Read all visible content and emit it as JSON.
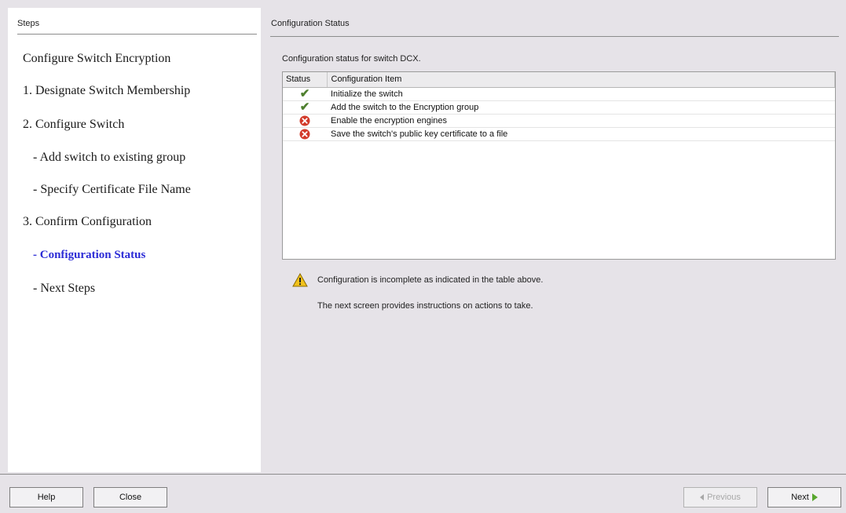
{
  "steps_panel": {
    "header": "Steps",
    "items": [
      {
        "label": "Configure Switch Encryption",
        "current": false
      },
      {
        "label": "1. Designate Switch Membership",
        "current": false
      },
      {
        "label": "2. Configure Switch",
        "current": false
      },
      {
        "label": "- Add switch to existing group",
        "current": false
      },
      {
        "label": "- Specify Certificate File Name",
        "current": false
      },
      {
        "label": "3. Confirm Configuration",
        "current": false
      },
      {
        "label": "- Configuration Status",
        "current": true
      },
      {
        "label": "- Next Steps",
        "current": false
      }
    ]
  },
  "content": {
    "header": "Configuration Status",
    "status_label": "Configuration status for switch DCX.",
    "table": {
      "columns": [
        "Status",
        "Configuration Item"
      ],
      "rows": [
        {
          "status": "check",
          "item": "Initialize the switch"
        },
        {
          "status": "check",
          "item": "Add the switch to the Encryption group"
        },
        {
          "status": "error",
          "item": "Enable the encryption engines"
        },
        {
          "status": "error",
          "item": "Save the switch's public key certificate to a file"
        }
      ]
    },
    "message": {
      "line1": "Configuration is incomplete as indicated in the table above.",
      "line2": "The next screen provides instructions on actions to take."
    }
  },
  "buttons": {
    "help": "Help",
    "close": "Close",
    "previous": "Previous",
    "next": "Next"
  },
  "colors": {
    "current_step": "#2b2bd6",
    "check": "#4e7f2e",
    "error": "#d23a2a",
    "warning": "#f2c21b",
    "next_arrow": "#58a72e"
  },
  "icons": {
    "ok": "check-icon",
    "failed": "error-icon",
    "alert": "warning-icon"
  }
}
